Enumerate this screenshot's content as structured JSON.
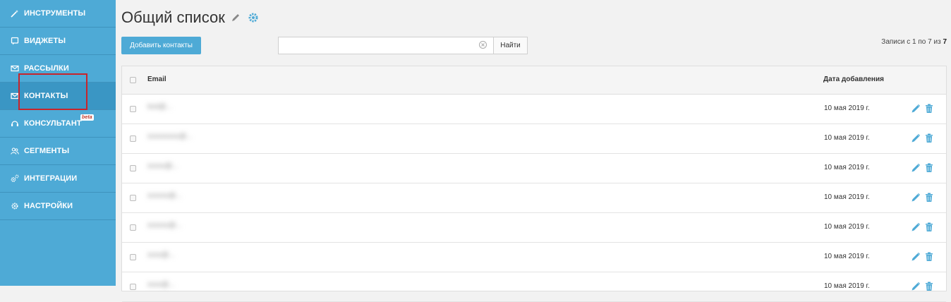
{
  "sidebar": {
    "items": [
      {
        "label": "Инструменты",
        "icon": "magic-wand-icon",
        "active": false
      },
      {
        "label": "Виджеты",
        "icon": "widget-icon",
        "active": false
      },
      {
        "label": "Рассылки",
        "icon": "envelope-icon",
        "active": false
      },
      {
        "label": "Контакты",
        "icon": "contacts-envelope-icon",
        "active": true
      },
      {
        "label": "Консультант",
        "icon": "headset-icon",
        "active": false,
        "badge": "beta"
      },
      {
        "label": "Сегменты",
        "icon": "users-icon",
        "active": false
      },
      {
        "label": "Интеграции",
        "icon": "gears-icon",
        "active": false
      },
      {
        "label": "Настройки",
        "icon": "gear-icon",
        "active": false
      }
    ]
  },
  "header": {
    "title": "Общий список"
  },
  "toolbar": {
    "add_label": "Добавить контакты",
    "search_value": "",
    "find_label": "Найти",
    "records_prefix": "Записи с",
    "records_from": "1",
    "records_mid": "по",
    "records_to": "7",
    "records_of": "из",
    "records_total": "7"
  },
  "table": {
    "columns": [
      "Email",
      "Дата добавления"
    ],
    "rows": [
      {
        "email": "test@...",
        "date": "10 мая 2019 г."
      },
      {
        "email": "xxxxxxxxx@...",
        "date": "10 мая 2019 г."
      },
      {
        "email": "xxxxx@...",
        "date": "10 мая 2019 г."
      },
      {
        "email": "xxxxxx@...",
        "date": "10 мая 2019 г."
      },
      {
        "email": "xxxxxx@...",
        "date": "10 мая 2019 г."
      },
      {
        "email": "xxxx@...",
        "date": "10 мая 2019 г."
      },
      {
        "email": "xxxx@...",
        "date": "10 мая 2019 г."
      }
    ]
  },
  "colors": {
    "sidebar": "#4eaad6",
    "sidebar_active": "#3a96c4",
    "accent": "#4eaad6",
    "highlight": "#c8242b"
  }
}
